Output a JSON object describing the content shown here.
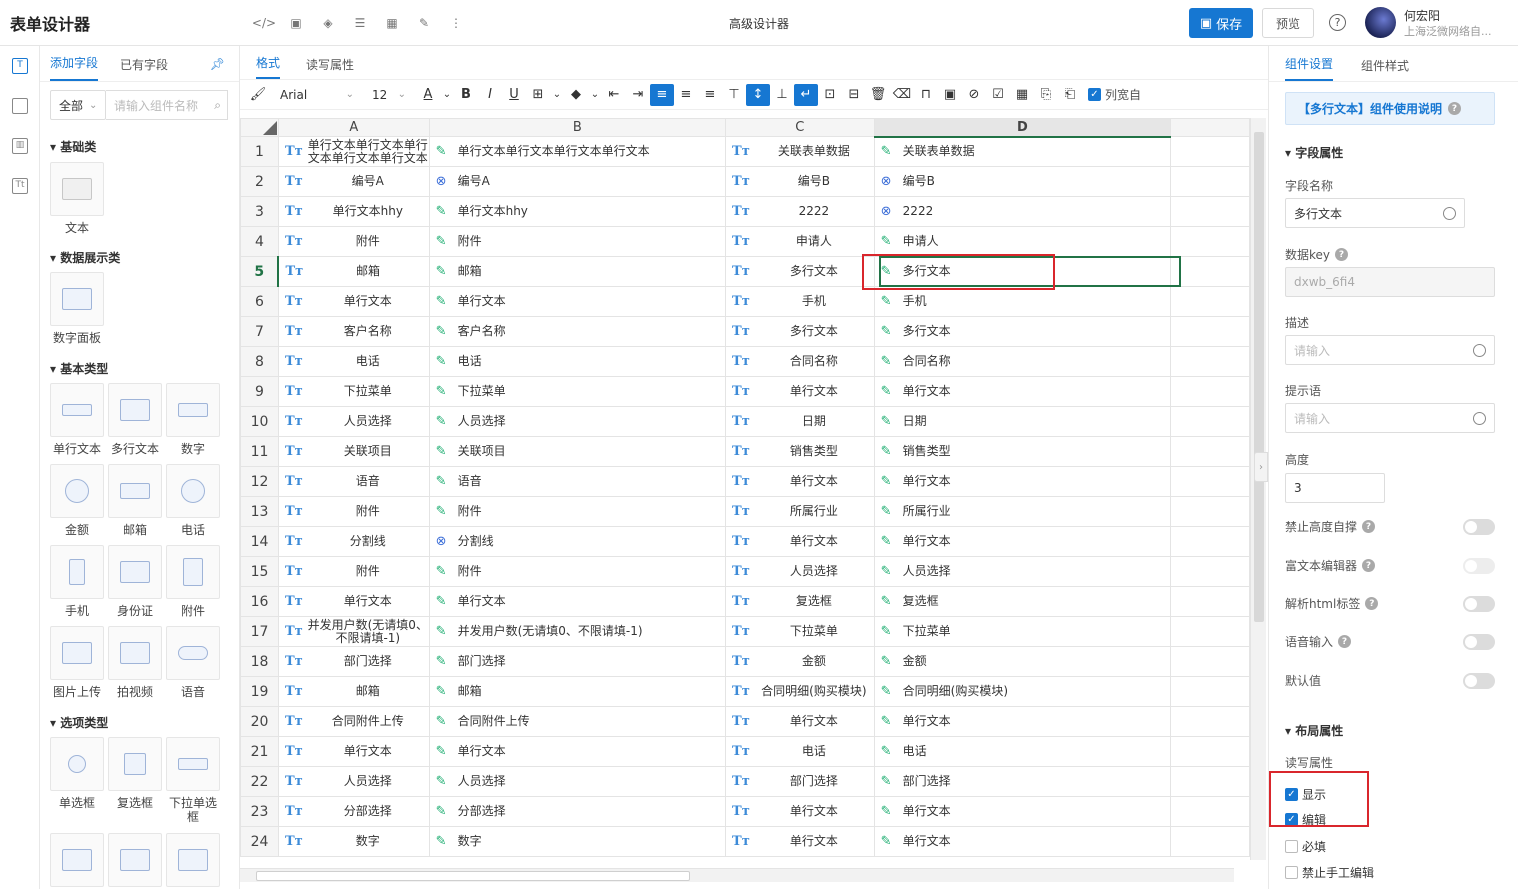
{
  "header": {
    "app_title": "表单设计器",
    "center_title": "高级设计器",
    "save_label": "保存",
    "preview_label": "预览",
    "help_label": "?",
    "user_name": "何宏阳",
    "user_org": "上海泛微网络自..."
  },
  "left_panel": {
    "tabs": [
      "添加字段",
      "已有字段"
    ],
    "filter_value": "全部",
    "search_placeholder": "请输入组件名称",
    "categories": {
      "basic": "基础类",
      "display": "数据展示类",
      "base_types": "基本类型",
      "options": "选项类型"
    },
    "items": {
      "text": "文本",
      "digit_panel": "数字面板",
      "single_text": "单行文本",
      "multi_text": "多行文本",
      "number": "数字",
      "amount": "金额",
      "email": "邮箱",
      "phone": "电话",
      "mobile": "手机",
      "id_card": "身份证",
      "attachment": "附件",
      "image_upload": "图片上传",
      "video": "拍视频",
      "voice": "语音",
      "radio": "单选框",
      "checkbox": "复选框",
      "dropdown_single": "下拉单选框"
    }
  },
  "center": {
    "tabs": [
      "格式",
      "读写属性"
    ],
    "toolbar": {
      "font": "Arial",
      "size": "12",
      "col_width_label": "列宽自"
    },
    "columns": [
      "A",
      "B",
      "C",
      "D"
    ],
    "rows": [
      {
        "n": "1",
        "a": "单行文本单行文本单行文本单行文本单行文本",
        "b": "单行文本单行文本单行文本单行文本",
        "bi": "p",
        "c": "关联表单数据",
        "d": "关联表单数据",
        "di": "p"
      },
      {
        "n": "2",
        "a": "编号A",
        "b": "编号A",
        "bi": "x",
        "c": "编号B",
        "d": "编号B",
        "di": "x"
      },
      {
        "n": "3",
        "a": "单行文本hhy",
        "b": "单行文本hhy",
        "bi": "p",
        "c": "2222",
        "d": "2222",
        "di": "x"
      },
      {
        "n": "4",
        "a": "附件",
        "b": "附件",
        "bi": "p",
        "c": "申请人",
        "d": "申请人",
        "di": "p"
      },
      {
        "n": "5",
        "a": "邮箱",
        "b": "邮箱",
        "bi": "p",
        "c": "多行文本",
        "d": "多行文本",
        "di": "p"
      },
      {
        "n": "6",
        "a": "单行文本",
        "b": "单行文本",
        "bi": "p",
        "c": "手机",
        "d": "手机",
        "di": "p"
      },
      {
        "n": "7",
        "a": "客户名称",
        "b": "客户名称",
        "bi": "p",
        "c": "多行文本",
        "d": "多行文本",
        "di": "p"
      },
      {
        "n": "8",
        "a": "电话",
        "b": "电话",
        "bi": "p",
        "c": "合同名称",
        "d": "合同名称",
        "di": "p"
      },
      {
        "n": "9",
        "a": "下拉菜单",
        "b": "下拉菜单",
        "bi": "p",
        "c": "单行文本",
        "d": "单行文本",
        "di": "p"
      },
      {
        "n": "10",
        "a": "人员选择",
        "b": "人员选择",
        "bi": "p",
        "c": "日期",
        "d": "日期",
        "di": "p"
      },
      {
        "n": "11",
        "a": "关联项目",
        "b": "关联项目",
        "bi": "p",
        "c": "销售类型",
        "d": "销售类型",
        "di": "p"
      },
      {
        "n": "12",
        "a": "语音",
        "b": "语音",
        "bi": "p",
        "c": "单行文本",
        "d": "单行文本",
        "di": "p"
      },
      {
        "n": "13",
        "a": "附件",
        "b": "附件",
        "bi": "p",
        "c": "所属行业",
        "d": "所属行业",
        "di": "p"
      },
      {
        "n": "14",
        "a": "分割线",
        "b": "分割线",
        "bi": "x",
        "c": "单行文本",
        "d": "单行文本",
        "di": "p"
      },
      {
        "n": "15",
        "a": "附件",
        "b": "附件",
        "bi": "p",
        "c": "人员选择",
        "d": "人员选择",
        "di": "p"
      },
      {
        "n": "16",
        "a": "单行文本",
        "b": "单行文本",
        "bi": "p",
        "c": "复选框",
        "d": "复选框",
        "di": "p"
      },
      {
        "n": "17",
        "a": "并发用户数(无请填0、不限请填-1)",
        "b": "并发用户数(无请填0、不限请填-1)",
        "bi": "p",
        "c": "下拉菜单",
        "d": "下拉菜单",
        "di": "p"
      },
      {
        "n": "18",
        "a": "部门选择",
        "b": "部门选择",
        "bi": "p",
        "c": "金额",
        "d": "金额",
        "di": "p"
      },
      {
        "n": "19",
        "a": "邮箱",
        "b": "邮箱",
        "bi": "p",
        "c": "合同明细(购买模块)",
        "d": "合同明细(购买模块)",
        "di": "p"
      },
      {
        "n": "20",
        "a": "合同附件上传",
        "b": "合同附件上传",
        "bi": "p",
        "c": "单行文本",
        "d": "单行文本",
        "di": "p"
      },
      {
        "n": "21",
        "a": "单行文本",
        "b": "单行文本",
        "bi": "p",
        "c": "电话",
        "d": "电话",
        "di": "p"
      },
      {
        "n": "22",
        "a": "人员选择",
        "b": "人员选择",
        "bi": "p",
        "c": "部门选择",
        "d": "部门选择",
        "di": "p"
      },
      {
        "n": "23",
        "a": "分部选择",
        "b": "分部选择",
        "bi": "p",
        "c": "单行文本",
        "d": "单行文本",
        "di": "p"
      },
      {
        "n": "24",
        "a": "数字",
        "b": "数字",
        "bi": "p",
        "c": "单行文本",
        "d": "单行文本",
        "di": "p"
      }
    ]
  },
  "right_panel": {
    "tabs": [
      "组件设置",
      "组件样式"
    ],
    "help_banner": "【多行文本】组件使用说明",
    "field_section": "字段属性",
    "field_name_label": "字段名称",
    "field_name_value": "多行文本",
    "data_key_label": "数据key",
    "data_key_value": "dxwb_6fi4",
    "desc_label": "描述",
    "desc_placeholder": "请输入",
    "hint_label": "提示语",
    "hint_placeholder": "请输入",
    "height_label": "高度",
    "height_value": "3",
    "toggles": [
      {
        "label": "禁止高度自撑",
        "help": true
      },
      {
        "label": "富文本编辑器",
        "help": true
      },
      {
        "label": "解析html标签",
        "help": true
      },
      {
        "label": "语音输入",
        "help": true
      },
      {
        "label": "默认值",
        "help": false
      }
    ],
    "layout_section": "布局属性",
    "rw_label": "读写属性",
    "checks": [
      {
        "label": "显示",
        "checked": true
      },
      {
        "label": "编辑",
        "checked": true
      },
      {
        "label": "必填",
        "checked": false
      },
      {
        "label": "禁止手工编辑",
        "checked": false
      }
    ]
  },
  "colors": {
    "accent": "#1677d2",
    "selection_green": "#217346",
    "highlight_red": "#d9262c"
  }
}
